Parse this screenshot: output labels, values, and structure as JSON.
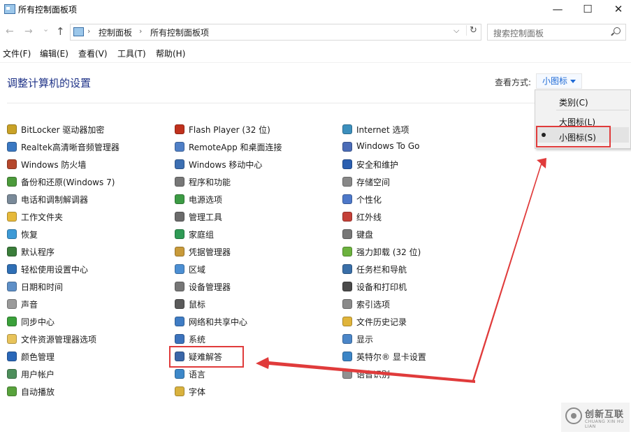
{
  "window": {
    "title": "所有控制面板项",
    "min_glyph": "—",
    "max_glyph": "☐",
    "close_glyph": "✕"
  },
  "nav": {
    "back_glyph": "←",
    "forward_glyph": "→",
    "recent_glyph": "⌄",
    "up_glyph": "↑"
  },
  "address": {
    "crumb1": "控制面板",
    "crumb2": "所有控制面板项",
    "sep": "›",
    "dropdown_glyph": "⌵",
    "refresh_glyph": "↻"
  },
  "search": {
    "placeholder": "搜索控制面板"
  },
  "menu": {
    "file": "文件(F)",
    "edit": "编辑(E)",
    "view": "查看(V)",
    "tools": "工具(T)",
    "help": "帮助(H)"
  },
  "header": {
    "title": "调整计算机的设置",
    "view_by_label": "查看方式:",
    "view_by_value": "小图标"
  },
  "view_menu": {
    "category": "类别(C)",
    "large": "大图标(L)",
    "small": "小图标(S)",
    "selected": "小图标(S)"
  },
  "items": {
    "col1": [
      "BitLocker 驱动器加密",
      "Realtek高清晰音频管理器",
      "Windows 防火墙",
      "备份和还原(Windows 7)",
      "电话和调制解调器",
      "工作文件夹",
      "恢复",
      "默认程序",
      "轻松使用设置中心",
      "日期和时间",
      "声音",
      "同步中心",
      "文件资源管理器选项",
      "颜色管理",
      "用户帐户",
      "自动播放"
    ],
    "col2": [
      "Flash Player (32 位)",
      "RemoteApp 和桌面连接",
      "Windows 移动中心",
      "程序和功能",
      "电源选项",
      "管理工具",
      "家庭组",
      "凭据管理器",
      "区域",
      "设备管理器",
      "鼠标",
      "网络和共享中心",
      "系统",
      "疑难解答",
      "语言",
      "字体"
    ],
    "col3": [
      "Internet 选项",
      "Windows To Go",
      "安全和维护",
      "存储空间",
      "个性化",
      "红外线",
      "键盘",
      "强力卸载 (32 位)",
      "任务栏和导航",
      "设备和打印机",
      "索引选项",
      "文件历史记录",
      "显示",
      "英特尔® 显卡设置",
      "语音识别"
    ]
  },
  "icon_colors": {
    "col1": [
      "#c9a227",
      "#3a78c2",
      "#b5472c",
      "#4c9a3b",
      "#7a8a99",
      "#e6b93a",
      "#3d9ad6",
      "#3a7d3a",
      "#2f6fb5",
      "#5e8fc7",
      "#9a9a9a",
      "#3aa03a",
      "#e8c35a",
      "#2a67b8",
      "#4d8e5b",
      "#58a23c"
    ],
    "col2": [
      "#c0311d",
      "#4f7fc6",
      "#3c6fb2",
      "#777777",
      "#3c9b44",
      "#6b6b6b",
      "#2f9a55",
      "#c89a3a",
      "#4c8fd3",
      "#767676",
      "#5a5a5a",
      "#3f7cc4",
      "#3c73bd",
      "#3a66a8",
      "#3d88c9",
      "#d9b23e"
    ],
    "col3": [
      "#3c8fbd",
      "#4b6cb7",
      "#2b5fb0",
      "#888888",
      "#4d78c9",
      "#c44038",
      "#777777",
      "#6cb23e",
      "#3a6fa8",
      "#4a4a4a",
      "#8a8a8a",
      "#e0b43a",
      "#4b86c8",
      "#3c85c6",
      "#909090"
    ]
  },
  "annotations": {
    "highlight_color": "#e03b3b"
  },
  "watermark": {
    "brand": "创新互联",
    "tagline": "CHUANG XIN HU LIAN"
  }
}
